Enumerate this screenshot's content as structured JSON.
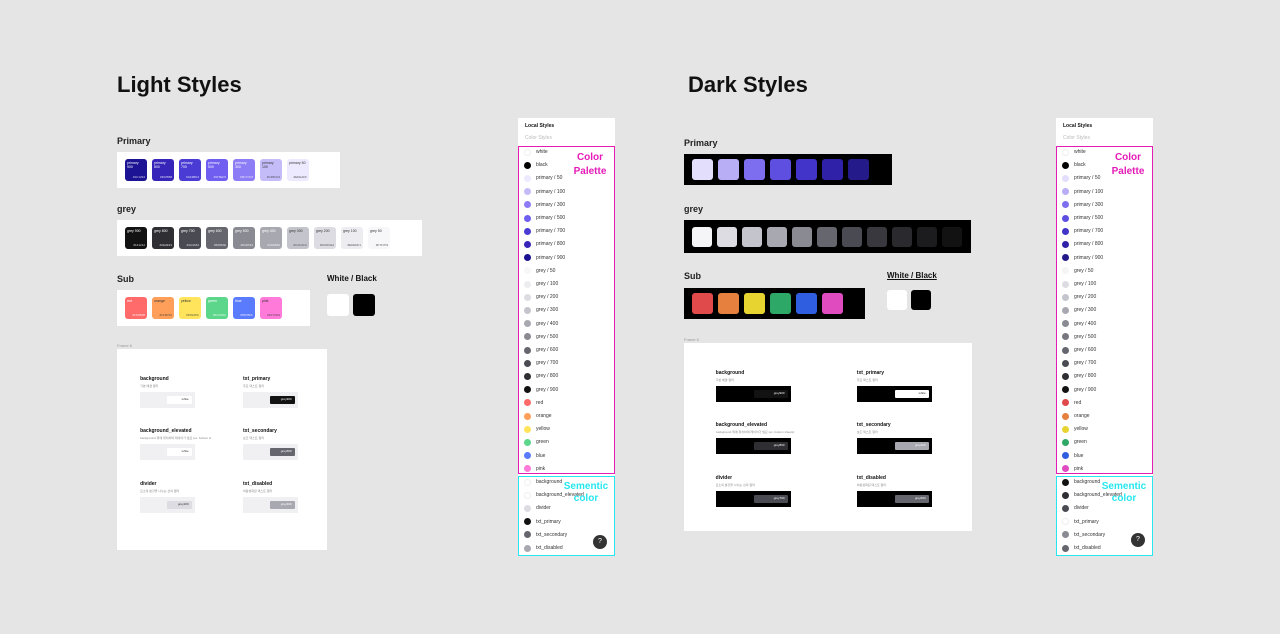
{
  "light": {
    "title": "Light Styles",
    "primary_title": "Primary",
    "grey_title": "grey",
    "sub_title": "Sub",
    "wb_title": "White / Black",
    "frame_label": "Frame 6",
    "primary_swatches": [
      {
        "name": "primary 900",
        "hex": "#1C1294",
        "color": "#1c1294"
      },
      {
        "name": "primary 800",
        "hex": "#3625B8",
        "color": "#3625b8"
      },
      {
        "name": "primary 700",
        "hex": "#4A3BD4",
        "color": "#4a3bd4"
      },
      {
        "name": "primary 500",
        "hex": "#6F5EF0",
        "color": "#6f5ef0"
      },
      {
        "name": "primary 300",
        "hex": "#8C7CF6",
        "color": "#8c7cf6"
      },
      {
        "name": "primary 100",
        "hex": "#C4BCF9",
        "color": "#c4bcf9"
      },
      {
        "name": "primary 50",
        "hex": "#EDEAFF",
        "color": "#edeaff"
      }
    ],
    "grey_swatches": [
      {
        "name": "grey 900",
        "hex": "#121212",
        "color": "#121212"
      },
      {
        "name": "grey 800",
        "hex": "#2E2E33",
        "color": "#2e2e33"
      },
      {
        "name": "grey 700",
        "hex": "#4A4A52",
        "color": "#4a4a52"
      },
      {
        "name": "grey 600",
        "hex": "#66666E",
        "color": "#66666e"
      },
      {
        "name": "grey 500",
        "hex": "#8A8A93",
        "color": "#8a8a93"
      },
      {
        "name": "grey 400",
        "hex": "#A8A8B0",
        "color": "#a8a8b0"
      },
      {
        "name": "grey 300",
        "hex": "#C4C4CC",
        "color": "#c4c4cc"
      },
      {
        "name": "grey 200",
        "hex": "#DCDCE2",
        "color": "#dcdce2"
      },
      {
        "name": "grey 100",
        "hex": "#EDEDF1",
        "color": "#ededf1"
      },
      {
        "name": "grey 50",
        "hex": "#F7F7F9",
        "color": "#f7f7f9"
      }
    ],
    "sub_swatches": [
      {
        "name": "red",
        "hex": "#FF6B6B",
        "color": "#ff6b6b"
      },
      {
        "name": "orange",
        "hex": "#FF9F5A",
        "color": "#ff9f5a"
      },
      {
        "name": "yellow",
        "hex": "#FFE45C",
        "color": "#ffe45c"
      },
      {
        "name": "green",
        "hex": "#5CD68A",
        "color": "#5cd68a"
      },
      {
        "name": "blue",
        "hex": "#5B7BFF",
        "color": "#5b7bff"
      },
      {
        "name": "pink",
        "hex": "#FF7AD9",
        "color": "#ff7ad9"
      }
    ],
    "wb_swatches": [
      {
        "name": "white",
        "color": "#ffffff"
      },
      {
        "name": "black",
        "color": "#000000"
      }
    ],
    "semantic": [
      {
        "title": "background",
        "desc": "기본 배경 컬러",
        "demo": "white"
      },
      {
        "title": "txt_primary",
        "desc": "주요 텍스트 컬러",
        "demo": "grey900"
      },
      {
        "title": "background_elevated",
        "desc": "background 위에 위치하며 레이어가 필요 (ex. bottom sheets)",
        "demo": "white"
      },
      {
        "title": "txt_secondary",
        "desc": "보조 텍스트 컬러",
        "demo": "grey600"
      },
      {
        "title": "divider",
        "desc": "요소의 분할을 나누는 선의 컬러",
        "demo": "grey200"
      },
      {
        "title": "txt_disabled",
        "desc": "비활성화된 텍스트 컬러",
        "demo": "grey400"
      }
    ]
  },
  "dark": {
    "title": "Dark  Styles",
    "primary_title": "Primary",
    "grey_title": "grey",
    "sub_title": "Sub",
    "wb_title": "White / Black",
    "frame_label": "Frame 6",
    "primary_colors": [
      "#e2defc",
      "#b8aef5",
      "#7d6ef0",
      "#5e4fe0",
      "#4233c9",
      "#3022a8",
      "#241a8a"
    ],
    "grey_colors": [
      "#f5f5f7",
      "#dcdce2",
      "#c4c4cc",
      "#a8a8b0",
      "#8a8a93",
      "#66666e",
      "#4a4a52",
      "#38383e",
      "#2a2a2e",
      "#1c1c1f",
      "#121212"
    ],
    "sub_colors": [
      "#e04a4a",
      "#e5803e",
      "#e8d431",
      "#2ea866",
      "#2f5ee0",
      "#e04bbf"
    ],
    "semantic": [
      {
        "title": "background",
        "desc": "기본 배경 컬러",
        "demo": "grey900"
      },
      {
        "title": "txt_primary",
        "desc": "주요 텍스트 컬러",
        "demo": "white"
      },
      {
        "title": "background_elevated",
        "desc": "background 위에 위치하며 레이어가 필요 (ex. bottom sheets)",
        "demo": "grey800"
      },
      {
        "title": "txt_secondary",
        "desc": "보조 텍스트 컬러",
        "demo": "grey400"
      },
      {
        "title": "divider",
        "desc": "요소의 분할을 나누는 선의 컬러",
        "demo": "grey700"
      },
      {
        "title": "txt_disabled",
        "desc": "비활성화된 텍스트 컬러",
        "demo": "grey600"
      }
    ]
  },
  "panel": {
    "header": "Local Styles",
    "subheader": "Color Styles",
    "palette_note_line1": "Color",
    "palette_note_line2": "Palette",
    "semantic_note_line1": "Sementic",
    "semantic_note_line2": "color",
    "help": "?",
    "light_items": [
      {
        "label": "white",
        "color": "#ffffff"
      },
      {
        "label": "black",
        "color": "#000000"
      },
      {
        "label": "primary / 50",
        "color": "#edeaff"
      },
      {
        "label": "primary / 100",
        "color": "#c4bcf9"
      },
      {
        "label": "primary / 300",
        "color": "#8c7cf6"
      },
      {
        "label": "primary / 500",
        "color": "#6f5ef0"
      },
      {
        "label": "primary / 700",
        "color": "#4a3bd4"
      },
      {
        "label": "primary / 800",
        "color": "#3625b8"
      },
      {
        "label": "primary / 900",
        "color": "#1c1294"
      },
      {
        "label": "grey / 50",
        "color": "#f7f7f9"
      },
      {
        "label": "grey / 100",
        "color": "#ededf1"
      },
      {
        "label": "grey / 200",
        "color": "#dcdce2"
      },
      {
        "label": "grey / 300",
        "color": "#c4c4cc"
      },
      {
        "label": "grey / 400",
        "color": "#a8a8b0"
      },
      {
        "label": "grey / 500",
        "color": "#8a8a93"
      },
      {
        "label": "grey / 600",
        "color": "#66666e"
      },
      {
        "label": "grey / 700",
        "color": "#4a4a52"
      },
      {
        "label": "grey / 800",
        "color": "#2e2e33"
      },
      {
        "label": "grey / 900",
        "color": "#121212"
      },
      {
        "label": "red",
        "color": "#ff6b6b"
      },
      {
        "label": "orange",
        "color": "#ff9f5a"
      },
      {
        "label": "yellow",
        "color": "#ffe45c"
      },
      {
        "label": "green",
        "color": "#5cd68a"
      },
      {
        "label": "blue",
        "color": "#5b7bff"
      },
      {
        "label": "pink",
        "color": "#ff7ad9"
      },
      {
        "label": "background",
        "color": "#ffffff"
      },
      {
        "label": "background_elevated",
        "color": "#ffffff"
      },
      {
        "label": "divider",
        "color": "#dcdce2"
      },
      {
        "label": "txt_primary",
        "color": "#121212"
      },
      {
        "label": "txt_secondary",
        "color": "#66666e"
      },
      {
        "label": "txt_disabled",
        "color": "#a8a8b0"
      }
    ],
    "dark_items": [
      {
        "label": "white",
        "color": "#ffffff"
      },
      {
        "label": "black",
        "color": "#000000"
      },
      {
        "label": "primary / 50",
        "color": "#e2defc"
      },
      {
        "label": "primary / 100",
        "color": "#b8aef5"
      },
      {
        "label": "primary / 300",
        "color": "#7d6ef0"
      },
      {
        "label": "primary / 500",
        "color": "#5e4fe0"
      },
      {
        "label": "primary / 700",
        "color": "#4233c9"
      },
      {
        "label": "primary / 800",
        "color": "#3022a8"
      },
      {
        "label": "primary / 900",
        "color": "#241a8a"
      },
      {
        "label": "grey / 50",
        "color": "#f5f5f7"
      },
      {
        "label": "grey / 100",
        "color": "#dcdce2"
      },
      {
        "label": "grey / 200",
        "color": "#c4c4cc"
      },
      {
        "label": "grey / 300",
        "color": "#a8a8b0"
      },
      {
        "label": "grey / 400",
        "color": "#8a8a93"
      },
      {
        "label": "grey / 500",
        "color": "#77777f"
      },
      {
        "label": "grey / 600",
        "color": "#66666e"
      },
      {
        "label": "grey / 700",
        "color": "#4a4a52"
      },
      {
        "label": "grey / 800",
        "color": "#2e2e33"
      },
      {
        "label": "grey / 900",
        "color": "#121212"
      },
      {
        "label": "red",
        "color": "#e04a4a"
      },
      {
        "label": "orange",
        "color": "#e5803e"
      },
      {
        "label": "yellow",
        "color": "#e8d431"
      },
      {
        "label": "green",
        "color": "#2ea866"
      },
      {
        "label": "blue",
        "color": "#2f5ee0"
      },
      {
        "label": "pink",
        "color": "#e04bbf"
      },
      {
        "label": "background",
        "color": "#121212"
      },
      {
        "label": "background_elevated",
        "color": "#2e2e33"
      },
      {
        "label": "divider",
        "color": "#4a4a52"
      },
      {
        "label": "txt_primary",
        "color": "#ffffff"
      },
      {
        "label": "txt_secondary",
        "color": "#8a8a93"
      },
      {
        "label": "txt_disabled",
        "color": "#66666e"
      }
    ]
  }
}
